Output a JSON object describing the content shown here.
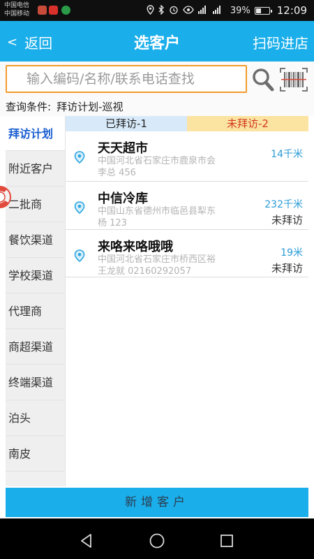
{
  "status_bar": {
    "carrier_1": "中国电信",
    "carrier_2": "中国移动",
    "battery": "39%",
    "time": "12:09",
    "icons": [
      "location-icon",
      "bluetooth-icon",
      "alarm-icon",
      "eye-icon",
      "signal-icon",
      "battery-icon"
    ]
  },
  "header": {
    "back_label": "返回",
    "back_chevron": "<",
    "title": "选客户",
    "scan_label": "扫码进店"
  },
  "search": {
    "placeholder": "输入编码/名称/联系电话查找"
  },
  "query": {
    "label": "查询条件:",
    "value": "拜访计划-巡视"
  },
  "sidebar": {
    "items": [
      {
        "label": "拜访计划",
        "active": true
      },
      {
        "label": "附近客户"
      },
      {
        "label": "二批商"
      },
      {
        "label": "餐饮渠道"
      },
      {
        "label": "学校渠道"
      },
      {
        "label": "代理商"
      },
      {
        "label": "商超渠道"
      },
      {
        "label": "终端渠道"
      },
      {
        "label": "泊头"
      },
      {
        "label": "南皮"
      }
    ]
  },
  "tabs": {
    "visited": "已拜访-1",
    "unvisited": "未拜访-2"
  },
  "customers": [
    {
      "name": "天天超市",
      "address": "中国河北省石家庄市鹿泉市会",
      "contact": "李总 456",
      "distance": "14千米",
      "status": ""
    },
    {
      "name": "中信冷库",
      "address": "中国山东省德州市临邑县犁东",
      "contact": "杨 123",
      "distance": "232千米",
      "status": "未拜访"
    },
    {
      "name": "来咯来咯哦哦",
      "address": "中国河北省石家庄市桥西区裕",
      "contact": "王龙就 02160292057",
      "distance": "19米",
      "status": "未拜访"
    }
  ],
  "footer": {
    "add_button": "新增客户"
  },
  "colors": {
    "accent": "#1aaeea",
    "search_border": "#f39b2b",
    "unvisited_tab_bg": "#fbe3a2",
    "unvisited_tab_text": "#d23a1a",
    "visited_tab_bg": "#d8eafa",
    "sidebar_active": "#1a5fd1"
  }
}
